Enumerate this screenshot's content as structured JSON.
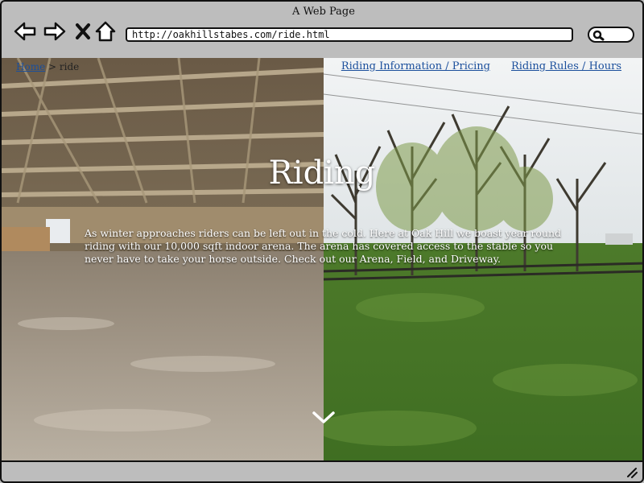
{
  "window": {
    "title": "A Web Page"
  },
  "browser": {
    "url": "http://oakhillstabes.com/ride.html",
    "back_icon": "arrow-left-icon",
    "forward_icon": "arrow-right-icon",
    "stop_icon": "close-icon",
    "home_icon": "home-icon",
    "search_icon": "search-icon"
  },
  "breadcrumb": {
    "home": "Home",
    "separator": ">",
    "current": "ride"
  },
  "nav": {
    "links": [
      "Riding Information / Pricing",
      "Riding Rules / Hours"
    ]
  },
  "hero": {
    "title": "Riding",
    "text": "As winter approaches riders can be left out in the cold. Here at Oak Hill we boast year round riding with our 10,000 sqft indoor arena. The arena has covered access to the stable so you never have to take your horse outside. Check out our Arena, Field, and Driveway.",
    "scroll_icon": "chevron-down-icon"
  },
  "colors": {
    "link": "#1b4f9c",
    "chrome": "#bdbdbd"
  }
}
